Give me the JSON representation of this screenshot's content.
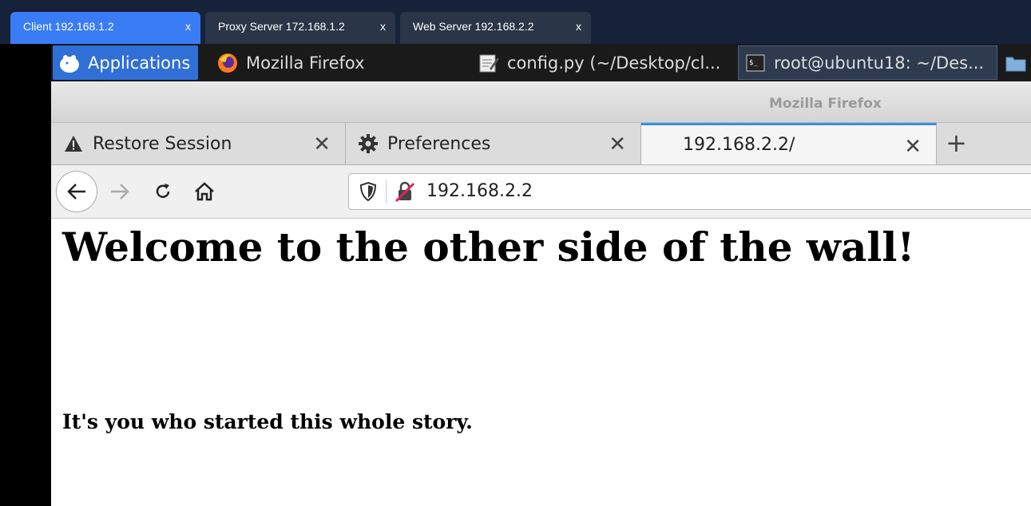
{
  "remote_tabs": [
    {
      "label": "Client 192.168.1.2",
      "close": "x",
      "active": true
    },
    {
      "label": "Proxy Server 172.168.1.2",
      "close": "x",
      "active": false
    },
    {
      "label": "Web Server 192.168.2.2",
      "close": "x",
      "active": false
    }
  ],
  "panel": {
    "applications": "Applications",
    "firefox": "Mozilla Firefox",
    "config": "config.py (~/Desktop/cl...",
    "terminal": "root@ubuntu18: ~/Des..."
  },
  "window": {
    "title": "Mozilla Firefox"
  },
  "tabs": [
    {
      "label": "Restore Session",
      "icon": "warning-icon",
      "close": "✕"
    },
    {
      "label": "Preferences",
      "icon": "gear-icon",
      "close": "✕"
    },
    {
      "label": "192.168.2.2/",
      "icon": "",
      "close": "✕",
      "active": true
    }
  ],
  "new_tab": "+",
  "url": "192.168.2.2",
  "page": {
    "heading": "Welcome to the other side of the wall!",
    "subheading": "It's you who started this whole story."
  },
  "colors": {
    "accent": "#3a7cf6",
    "panel_active": "#2f6fd6",
    "tab_highlight": "#3a8ee6"
  }
}
